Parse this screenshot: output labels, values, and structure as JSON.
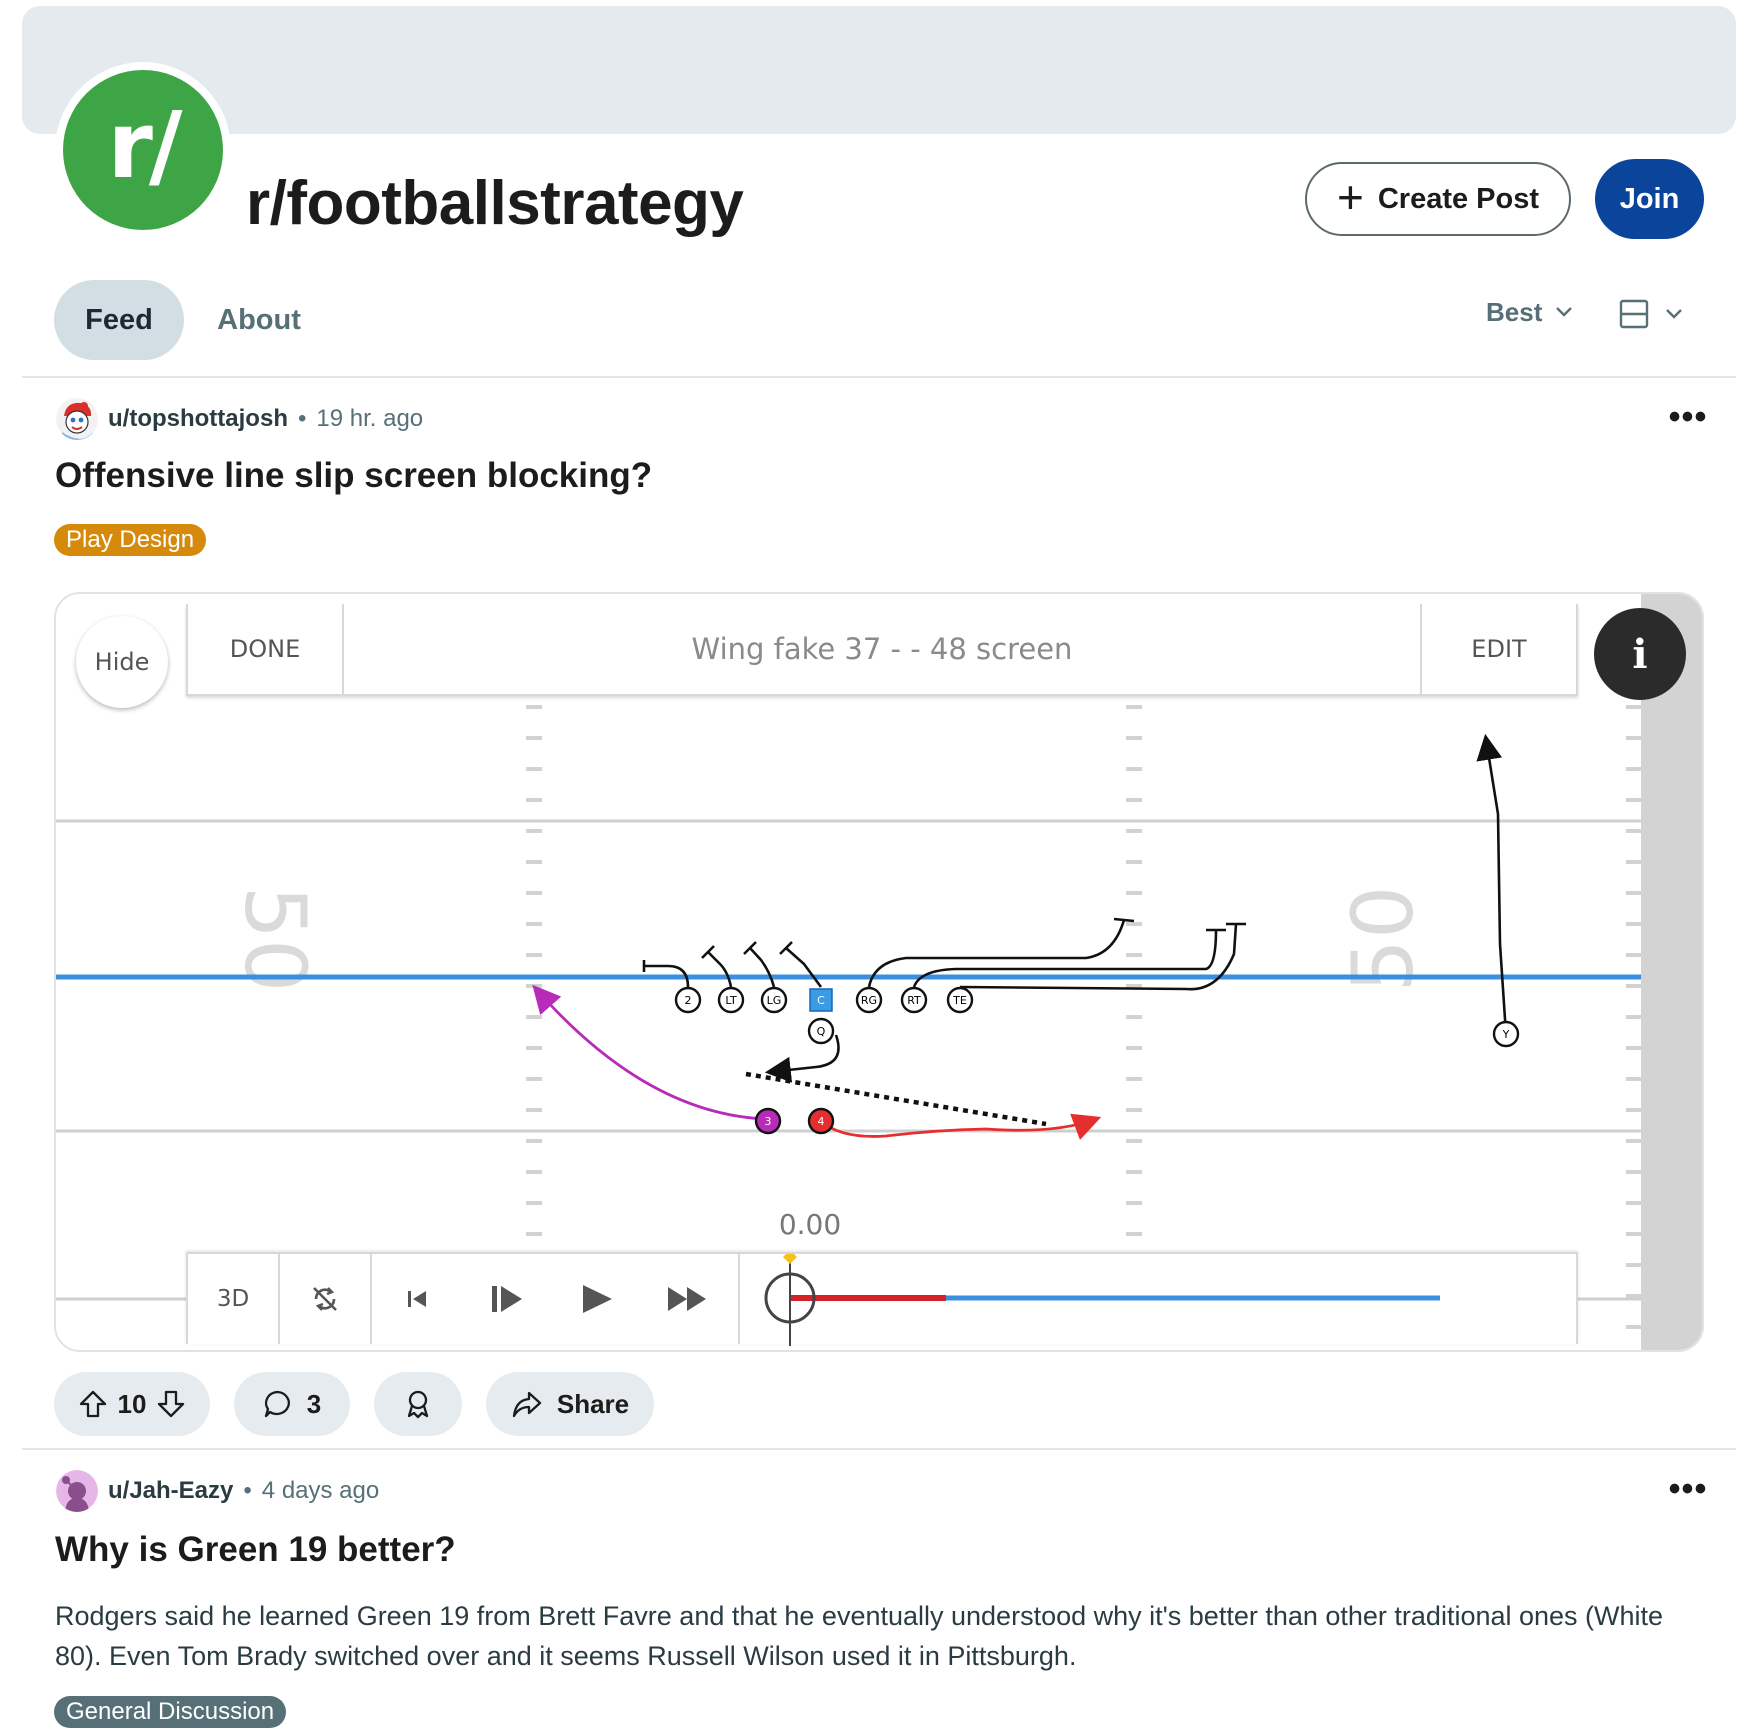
{
  "subreddit": {
    "icon_text": "r/",
    "name": "r/footballstrategy",
    "create_post_label": "Create Post",
    "join_label": "Join"
  },
  "tabs": [
    {
      "label": "Feed",
      "active": true
    },
    {
      "label": "About",
      "active": false
    }
  ],
  "sort": {
    "label": "Best",
    "icon": "chevron-down-icon"
  },
  "view": {
    "icon": "card-layout-icon"
  },
  "posts": [
    {
      "author": "u/topshottajosh",
      "time": "19 hr. ago",
      "title": "Offensive line slip screen blocking?",
      "flair": "Play Design",
      "flair_color": "#d68a0c",
      "media": {
        "hide_label": "Hide",
        "done_label": "DONE",
        "play_title": "Wing fake 37 - - 48 screen",
        "edit_label": "EDIT",
        "info_label": "i",
        "three_d_label": "3D",
        "timeline_value": "0.00",
        "timeline_progress": 0.24,
        "yard_numbers": [
          "50",
          "50"
        ],
        "players": [
          "2",
          "LT",
          "LG",
          "C",
          "RG",
          "RT",
          "TE",
          "Q",
          "Y",
          "3",
          "4"
        ]
      },
      "votes": "10",
      "comments": "3",
      "share_label": "Share"
    },
    {
      "author": "u/Jah-Eazy",
      "time": "4 days ago",
      "title": "Why is Green 19 better?",
      "body": "Rodgers said he learned Green 19 from Brett Favre and that he eventually understood why it's better than other traditional ones (White 80). Even Tom Brady switched over and it seems Russell Wilson used it in Pittsburgh.",
      "flair": "General Discussion",
      "flair_color": "#576f76"
    }
  ],
  "colors": {
    "join_button": "#0a449b",
    "community_icon": "#3ea546",
    "line_of_scrimmage": "#3b8fe0",
    "route_magenta": "#b62bb8",
    "route_red": "#e52f2f"
  }
}
